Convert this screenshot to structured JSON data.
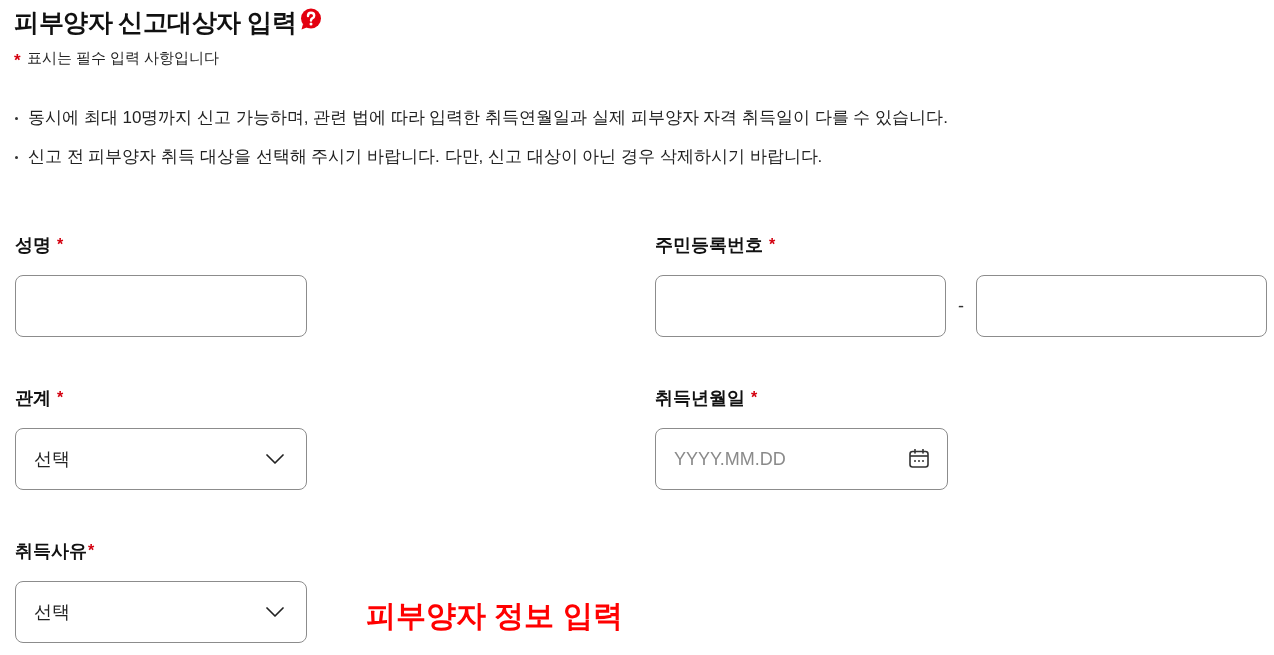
{
  "header": {
    "title": "피부양자 신고대상자 입력",
    "required_note": {
      "mark": "*",
      "text": "표시는 필수 입력 사항입니다"
    }
  },
  "notices": [
    "동시에 최대 10명까지 신고 가능하며, 관련 법에 따라 입력한 취득연월일과 실제 피부양자 자격 취득일이 다를 수 있습니다.",
    "신고 전 피부양자 취득 대상을 선택해 주시기 바랍니다. 다만, 신고 대상이 아닌 경우 삭제하시기 바랍니다."
  ],
  "form": {
    "rows": [
      [
        {
          "kind": "text",
          "label": "성명",
          "required_mark": "*"
        },
        {
          "kind": "split",
          "label": "주민등록번호",
          "required_mark": "*",
          "separator": "-"
        }
      ],
      [
        {
          "kind": "select",
          "label": "관계",
          "required_mark": "*",
          "value": "선택"
        },
        {
          "kind": "date",
          "label": "취득년월일",
          "required_mark": "*",
          "placeholder": "YYYY.MM.DD"
        }
      ],
      [
        {
          "kind": "select",
          "label": "취득사유",
          "required_mark": "*",
          "value": "선택"
        },
        {
          "kind": "annotation",
          "text": "피부양자 정보 입력"
        }
      ]
    ]
  }
}
